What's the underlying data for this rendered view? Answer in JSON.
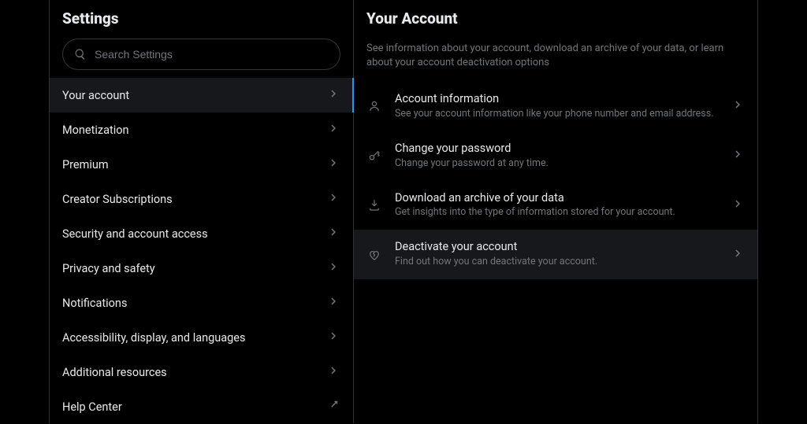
{
  "left": {
    "title": "Settings",
    "search_placeholder": "Search Settings",
    "items": [
      {
        "label": "Your account",
        "active": true,
        "external": false
      },
      {
        "label": "Monetization",
        "active": false,
        "external": false
      },
      {
        "label": "Premium",
        "active": false,
        "external": false
      },
      {
        "label": "Creator Subscriptions",
        "active": false,
        "external": false
      },
      {
        "label": "Security and account access",
        "active": false,
        "external": false
      },
      {
        "label": "Privacy and safety",
        "active": false,
        "external": false
      },
      {
        "label": "Notifications",
        "active": false,
        "external": false
      },
      {
        "label": "Accessibility, display, and languages",
        "active": false,
        "external": false
      },
      {
        "label": "Additional resources",
        "active": false,
        "external": false
      },
      {
        "label": "Help Center",
        "active": false,
        "external": true
      }
    ]
  },
  "right": {
    "title": "Your Account",
    "description": "See information about your account, download an archive of your data, or learn about your account deactivation options",
    "options": [
      {
        "icon": "person",
        "title": "Account information",
        "subtitle": "See your account information like your phone number and email address.",
        "highlight": false
      },
      {
        "icon": "key",
        "title": "Change your password",
        "subtitle": "Change your password at any time.",
        "highlight": false
      },
      {
        "icon": "download",
        "title": "Download an archive of your data",
        "subtitle": "Get insights into the type of information stored for your account.",
        "highlight": false
      },
      {
        "icon": "heartbreak",
        "title": "Deactivate your account",
        "subtitle": "Find out how you can deactivate your account.",
        "highlight": true
      }
    ]
  }
}
